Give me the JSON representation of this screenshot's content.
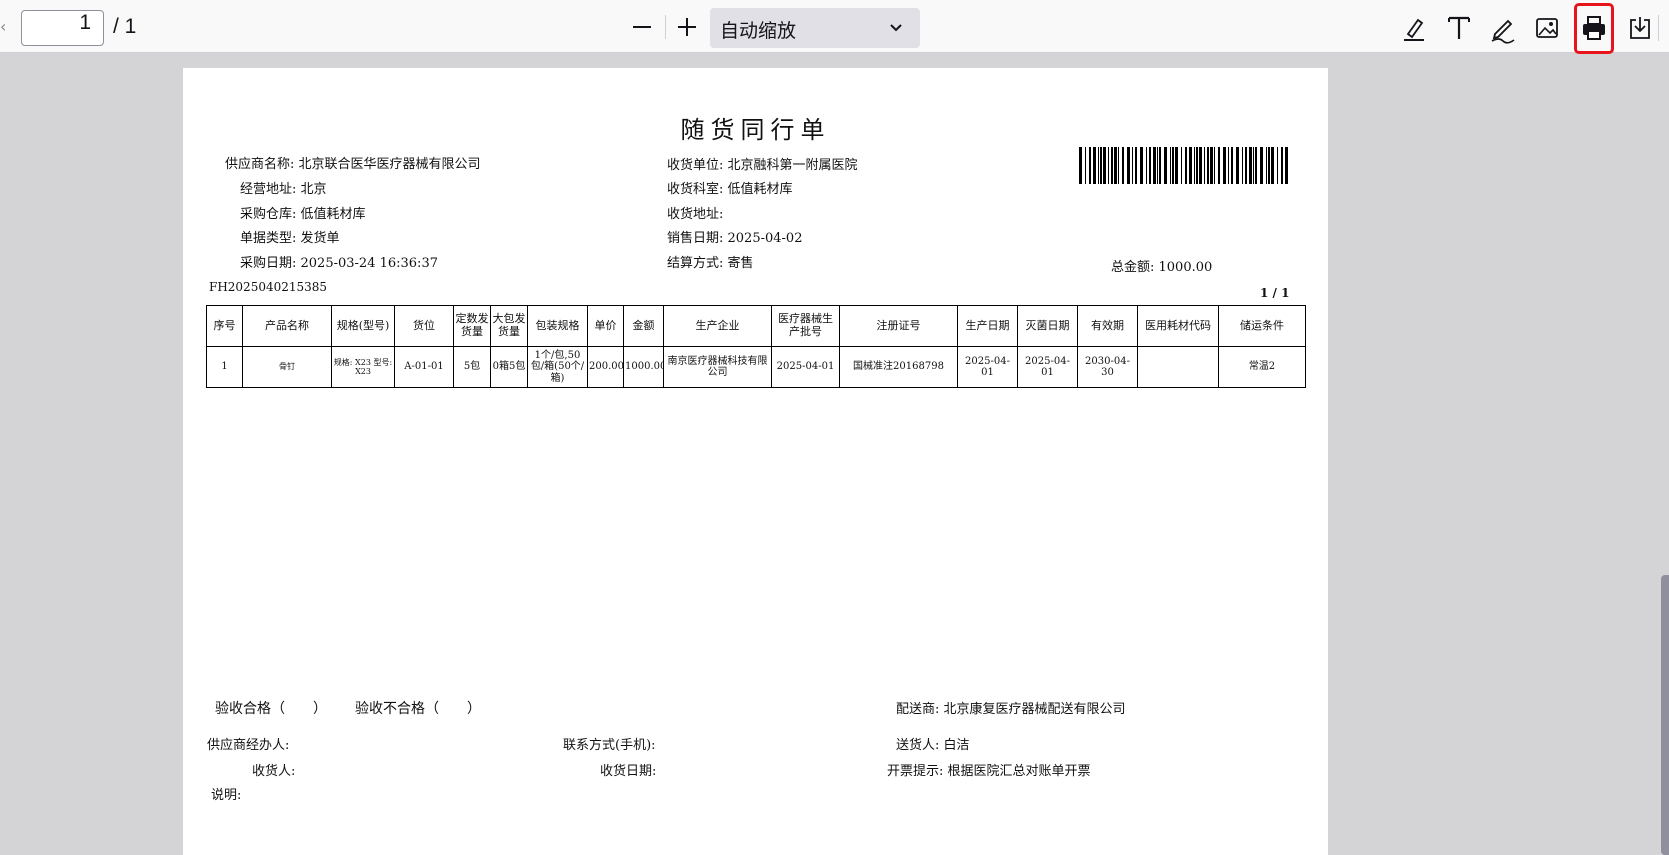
{
  "toolbar": {
    "page_current": "1",
    "page_total": "/ 1",
    "zoom_label": "自动缩放"
  },
  "colors": {
    "highlight": "#e8141c",
    "toolbar_bg": "#f9f9fa",
    "viewer_bg": "#d4d4d7"
  },
  "doc": {
    "title": "随货同行单",
    "left_fields": [
      "供应商名称:  北京联合医华医疗器械有限公司",
      "经营地址:  北京",
      "采购仓库:  低值耗材库",
      "单据类型:  发货单",
      "采购日期:  2025-03-24 16:36:37"
    ],
    "mid_fields": [
      "收货单位:  北京融科第一附属医院",
      "收货科室:  低值耗材库",
      "收货地址:",
      "销售日期:  2025-04-02",
      "结算方式:  寄售"
    ],
    "total": "总金额:  1000.00",
    "doc_no": "FH2025040215385",
    "page_no": "1 / 1",
    "table": {
      "headers": [
        "序号",
        "产品名称",
        "规格(型号)",
        "货位",
        "定数发货量",
        "大包发货量",
        "包装规格",
        "单价",
        "金额",
        "生产企业",
        "医疗器械生产批号",
        "注册证号",
        "生产日期",
        "灭菌日期",
        "有效期",
        "医用耗材代码",
        "储运条件"
      ],
      "rows": [
        [
          "1",
          "骨钉",
          "规格: X23 型号: X23",
          "A-01-01",
          "5包",
          "0箱5包",
          "1个/包,50包/箱(50个/箱)",
          "200.00",
          "1000.00",
          "南京医疗器械科技有限公司",
          "2025-04-01",
          "国械准注20168798",
          "2025-04-01",
          "2025-04-01",
          "2030-04-30",
          "",
          "常温2"
        ]
      ]
    },
    "footer": {
      "accept_ok": "验收合格（　　）",
      "accept_fail": "验收不合格（　　）",
      "distributor": "配送商:  北京康复医疗器械配送有限公司",
      "supplier_agent": "供应商经办人:",
      "contact": "联系方式(手机):",
      "courier": "送货人:  白洁",
      "receiver": "收货人:",
      "receive_date": "收货日期:",
      "invoice_hint": "开票提示:  根据医院汇总对账单开票",
      "note": "说明:"
    }
  }
}
